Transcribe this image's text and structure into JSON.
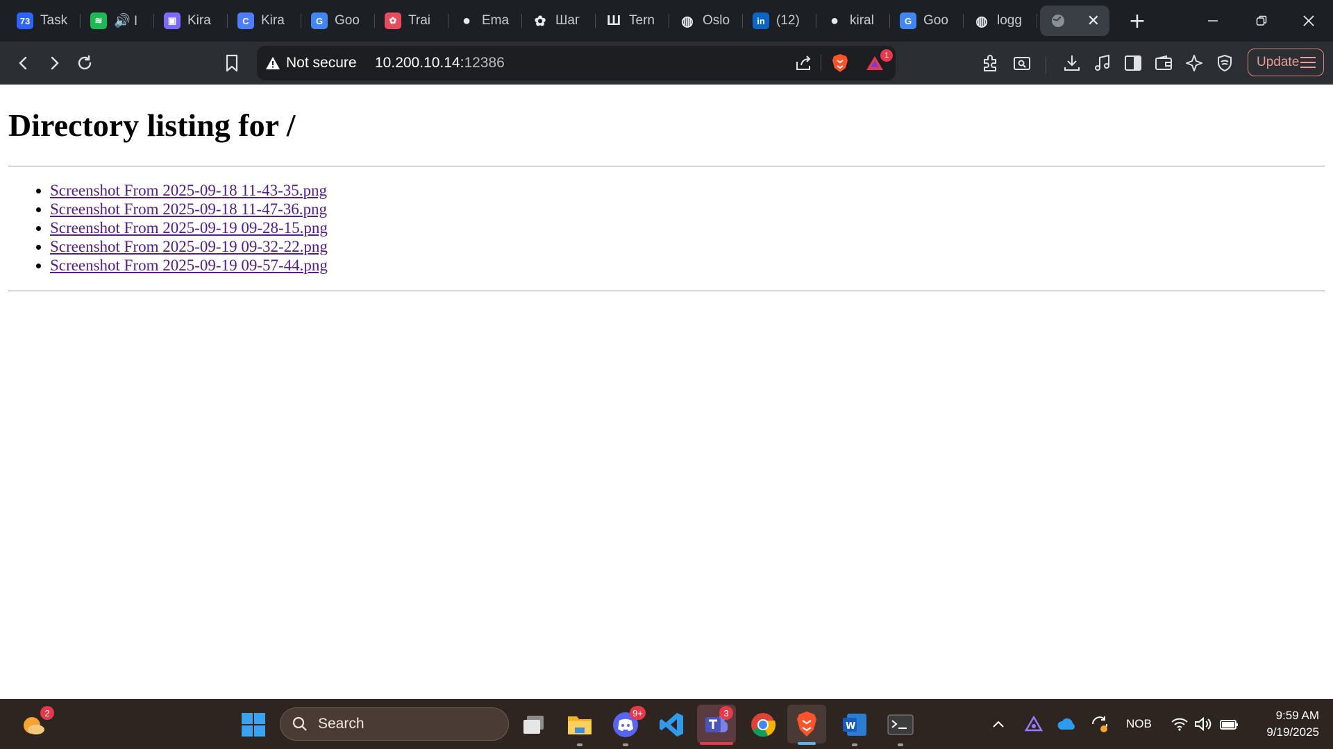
{
  "tabs": [
    {
      "label": "Task",
      "icon": "task-app-icon",
      "color": "#2f63ff",
      "glyph": "73"
    },
    {
      "label": "🔊 I",
      "icon": "spotify-icon",
      "color": "#1db954",
      "glyph": "≋"
    },
    {
      "label": "Kira",
      "icon": "kira-app-icon",
      "color": "#7b6cff",
      "glyph": "▣"
    },
    {
      "label": "Kira",
      "icon": "c-logo-icon",
      "color": "#4f7dff",
      "glyph": "C"
    },
    {
      "label": "Goo",
      "icon": "google-translate-icon",
      "color": "#4285f4",
      "glyph": "G"
    },
    {
      "label": "Trai",
      "icon": "openai-red-icon",
      "color": "#e84b5c",
      "glyph": "✿"
    },
    {
      "label": "Ema",
      "icon": "github-icon",
      "color": "#1c1f24",
      "glyph": "●"
    },
    {
      "label": "Шаг",
      "icon": "openai-icon",
      "color": "#1c1f24",
      "glyph": "✿"
    },
    {
      "label": "Tern",
      "icon": "terminal-bars-icon",
      "color": "#1c1f24",
      "glyph": "Ш"
    },
    {
      "label": "Oslo",
      "icon": "globe-icon",
      "color": "#1c1f24",
      "glyph": "◍"
    },
    {
      "label": "(12)",
      "icon": "linkedin-icon",
      "color": "#0a66c2",
      "glyph": "in"
    },
    {
      "label": "kiral",
      "icon": "github-dark-icon",
      "color": "#1c1f24",
      "glyph": "●"
    },
    {
      "label": "Goo",
      "icon": "google-translate-icon",
      "color": "#4285f4",
      "glyph": "G"
    },
    {
      "label": "logg",
      "icon": "globe-icon",
      "color": "#1c1f24",
      "glyph": "◍"
    }
  ],
  "active_tab": {
    "label": "",
    "icon": "globe-icon"
  },
  "toolbar": {
    "security_label": "Not secure",
    "url_host": "10.200.10.14:",
    "url_port": "12386",
    "notification_count": "1",
    "update_label": "Update"
  },
  "page": {
    "title": "Directory listing for /",
    "files": [
      "Screenshot From 2025-09-18 11-43-35.png",
      "Screenshot From 2025-09-18 11-47-36.png",
      "Screenshot From 2025-09-19 09-28-15.png",
      "Screenshot From 2025-09-19 09-32-22.png",
      "Screenshot From 2025-09-19 09-57-44.png"
    ]
  },
  "taskbar": {
    "weather_badge": "2",
    "search_placeholder": "Search",
    "discord_badge": "9+",
    "teams_badge": "3",
    "language": "NOB",
    "time": "9:59 AM",
    "date": "9/19/2025"
  },
  "colors": {
    "link": "#551a8b",
    "tab_bar": "#1c1f24",
    "toolbar": "#2b2e33",
    "taskbar": "#2e2420",
    "update_accent": "#e07f76"
  }
}
